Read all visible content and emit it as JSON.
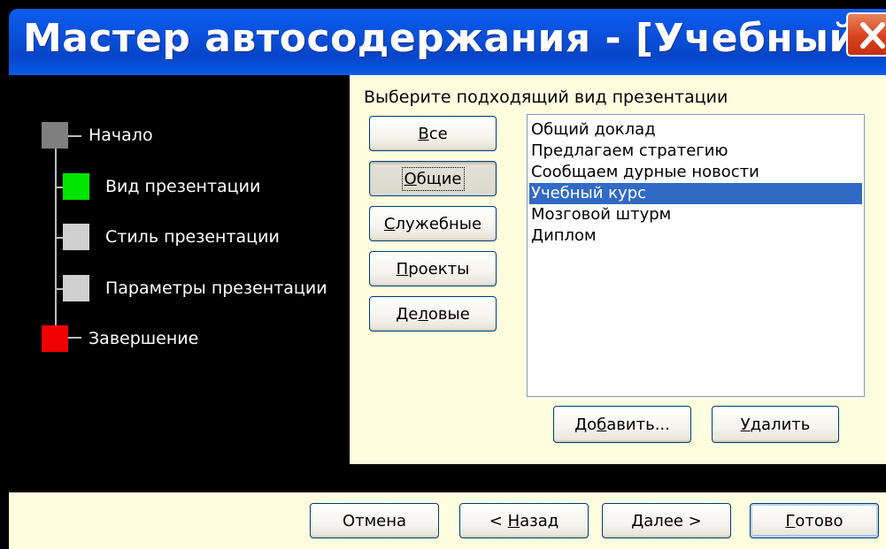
{
  "window": {
    "title": "Мастер автосодержания - [Учебный курс]"
  },
  "steps": [
    {
      "label": "Начало",
      "color": "#7f7f7f"
    },
    {
      "label": "Вид презентации",
      "color": "#00e600"
    },
    {
      "label": "Стиль презентации",
      "color": "#d0d0d0"
    },
    {
      "label": "Параметры презентации",
      "color": "#d0d0d0"
    },
    {
      "label": "Завершение",
      "color": "#f00000"
    }
  ],
  "main": {
    "heading": "Выберите подходящий вид презентации",
    "categories": [
      {
        "pre": "",
        "mnemonic": "В",
        "post": "се"
      },
      {
        "pre": "",
        "mnemonic": "О",
        "post": "бщие"
      },
      {
        "pre": "",
        "mnemonic": "С",
        "post": "лужебные"
      },
      {
        "pre": "",
        "mnemonic": "П",
        "post": "роекты"
      },
      {
        "pre": "Де",
        "mnemonic": "л",
        "post": "овые"
      }
    ],
    "selected_category": "Общие",
    "presentations": [
      "Общий доклад",
      "Предлагаем стратегию",
      "Сообщаем дурные новости",
      "Учебный курс",
      "Мозговой штурм",
      "Диплом"
    ],
    "selected_presentation": "Учебный курс",
    "add_button": {
      "pre": "До",
      "mnemonic": "б",
      "post": "авить..."
    },
    "delete_button": {
      "pre": "",
      "mnemonic": "У",
      "post": "далить"
    }
  },
  "footer": {
    "cancel": {
      "pre": "Отмена",
      "mnemonic": "",
      "post": ""
    },
    "back": {
      "pre": "< ",
      "mnemonic": "Н",
      "post": "азад"
    },
    "next": {
      "pre": "",
      "mnemonic": "Д",
      "post": "алее >"
    },
    "finish": {
      "pre": "",
      "mnemonic": "Г",
      "post": "отово"
    }
  },
  "colors": {
    "title_bar": "#0a4fd8",
    "panel_background": "#ffffe0",
    "selection": "#316ac5",
    "close_button": "#d9411d"
  }
}
